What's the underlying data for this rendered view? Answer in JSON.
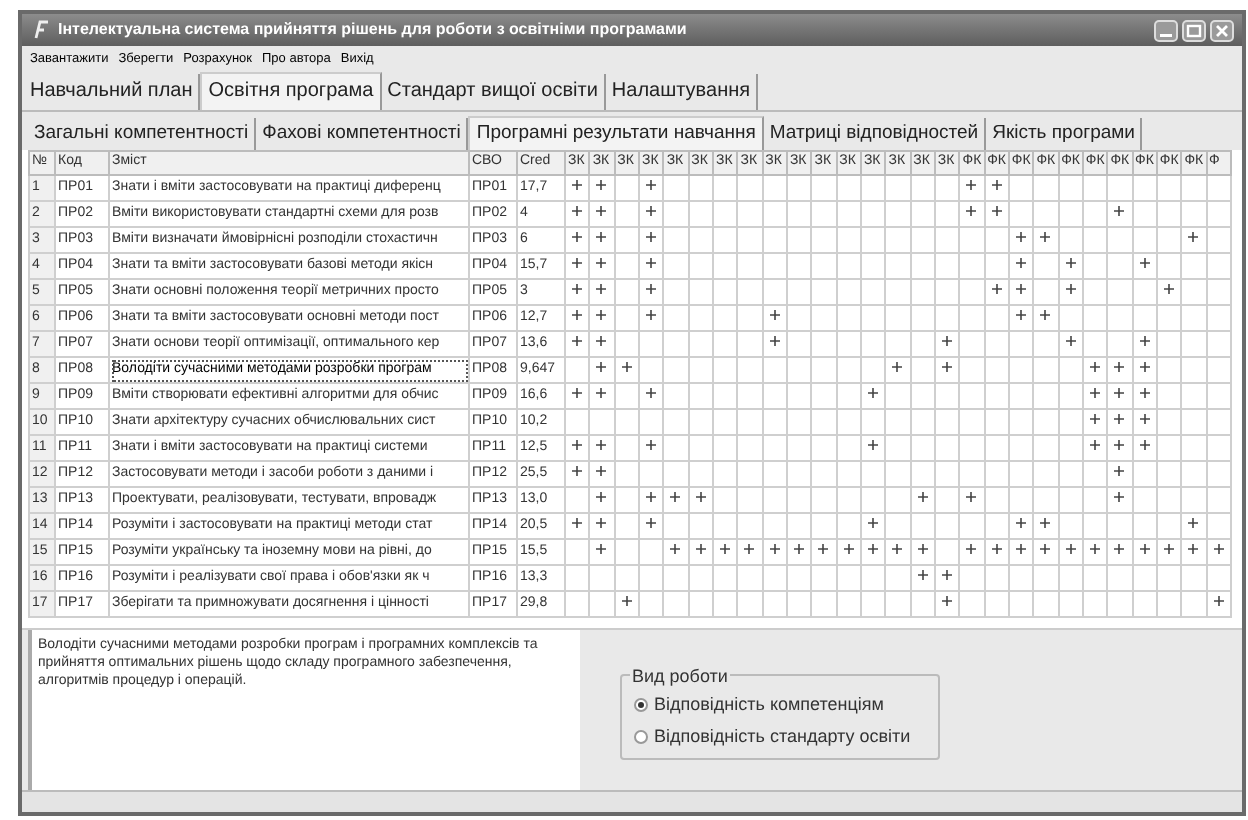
{
  "window": {
    "title": "Інтелектуальна система прийняття рішень для роботи з освітніми програмами"
  },
  "menu": [
    "Завантажити",
    "Зберегти",
    "Розрахунок",
    "Про автора",
    "Вихід"
  ],
  "tabs": [
    {
      "label": "Навчальний план",
      "selected": false
    },
    {
      "label": "Освітня програма",
      "selected": true
    },
    {
      "label": "Стандарт вищої освіти",
      "selected": false
    },
    {
      "label": "Налаштування",
      "selected": false
    }
  ],
  "subtabs": [
    {
      "label": "Загальні компетентності",
      "selected": false
    },
    {
      "label": "Фахові компетентності",
      "selected": false
    },
    {
      "label": "Програмні результати навчання",
      "selected": true
    },
    {
      "label": "Матриці відповідностей",
      "selected": false
    },
    {
      "label": "Якість програми",
      "selected": false
    }
  ],
  "table": {
    "columns": [
      "№",
      "Код",
      "Зміст",
      "СВО",
      "Cred",
      "ЗК",
      "ЗК",
      "ЗК",
      "ЗК",
      "ЗК",
      "ЗК",
      "ЗК",
      "ЗК",
      "ЗК",
      "ЗК",
      "ЗК",
      "ЗК",
      "ЗК",
      "ЗК",
      "ЗК",
      "ЗК",
      "ФК",
      "ФК",
      "ФК",
      "ФК",
      "ФК",
      "ФК",
      "ФК",
      "ФК",
      "ФК",
      "ФК",
      "Ф"
    ],
    "rows": [
      {
        "n": "1",
        "code": "ПР01",
        "text": "Знати і вміти застосовувати на практиці диференц",
        "svo": "ПР01",
        "cred": "17,7",
        "selected": false,
        "marks": [
          true,
          true,
          false,
          true,
          false,
          false,
          false,
          false,
          false,
          false,
          false,
          false,
          false,
          false,
          false,
          false,
          true,
          true,
          false,
          false,
          false,
          false,
          false,
          false,
          false,
          false,
          false
        ]
      },
      {
        "n": "2",
        "code": "ПР02",
        "text": "Вміти використовувати стандартні схеми для розв",
        "svo": "ПР02",
        "cred": "4",
        "selected": false,
        "marks": [
          true,
          true,
          false,
          true,
          false,
          false,
          false,
          false,
          false,
          false,
          false,
          false,
          false,
          false,
          false,
          false,
          true,
          true,
          false,
          false,
          false,
          false,
          true,
          false,
          false,
          false,
          false
        ]
      },
      {
        "n": "3",
        "code": "ПР03",
        "text": "Вміти визначати ймовірнісні розподіли стохастичн",
        "svo": "ПР03",
        "cred": "6",
        "selected": false,
        "marks": [
          true,
          true,
          false,
          true,
          false,
          false,
          false,
          false,
          false,
          false,
          false,
          false,
          false,
          false,
          false,
          false,
          false,
          false,
          true,
          true,
          false,
          false,
          false,
          false,
          false,
          true,
          false
        ]
      },
      {
        "n": "4",
        "code": "ПР04",
        "text": "Знати та вміти застосовувати базові методи якісн",
        "svo": "ПР04",
        "cred": "15,7",
        "selected": false,
        "marks": [
          true,
          true,
          false,
          true,
          false,
          false,
          false,
          false,
          false,
          false,
          false,
          false,
          false,
          false,
          false,
          false,
          false,
          false,
          true,
          false,
          true,
          false,
          false,
          true,
          false,
          false,
          false
        ]
      },
      {
        "n": "5",
        "code": "ПР05",
        "text": "Знати основні положення теорії метричних просто",
        "svo": "ПР05",
        "cred": "3",
        "selected": false,
        "marks": [
          true,
          true,
          false,
          true,
          false,
          false,
          false,
          false,
          false,
          false,
          false,
          false,
          false,
          false,
          false,
          false,
          false,
          true,
          true,
          false,
          true,
          false,
          false,
          false,
          true,
          false,
          false
        ]
      },
      {
        "n": "6",
        "code": "ПР06",
        "text": "Знати та вміти застосовувати основні методи пост",
        "svo": "ПР06",
        "cred": "12,7",
        "selected": false,
        "marks": [
          true,
          true,
          false,
          true,
          false,
          false,
          false,
          false,
          true,
          false,
          false,
          false,
          false,
          false,
          false,
          false,
          false,
          false,
          true,
          true,
          false,
          false,
          false,
          false,
          false,
          false,
          false
        ]
      },
      {
        "n": "7",
        "code": "ПР07",
        "text": "Знати основи теорії оптимізації, оптимального кер",
        "svo": "ПР07",
        "cred": "13,6",
        "selected": false,
        "marks": [
          true,
          true,
          false,
          false,
          false,
          false,
          false,
          false,
          true,
          false,
          false,
          false,
          false,
          false,
          false,
          true,
          false,
          false,
          false,
          false,
          true,
          false,
          false,
          true,
          false,
          false,
          false
        ]
      },
      {
        "n": "8",
        "code": "ПР08",
        "text": "Володіти сучасними методами розробки програм",
        "svo": "ПР08",
        "cred": "9,647",
        "selected": true,
        "marks": [
          false,
          true,
          true,
          false,
          false,
          false,
          false,
          false,
          false,
          false,
          false,
          false,
          false,
          true,
          false,
          true,
          false,
          false,
          false,
          false,
          false,
          true,
          true,
          true,
          false,
          false,
          false
        ]
      },
      {
        "n": "9",
        "code": "ПР09",
        "text": "Вміти створювати ефективні алгоритми для обчис",
        "svo": "ПР09",
        "cred": "16,6",
        "selected": false,
        "marks": [
          true,
          true,
          false,
          true,
          false,
          false,
          false,
          false,
          false,
          false,
          false,
          false,
          true,
          false,
          false,
          false,
          false,
          false,
          false,
          false,
          false,
          true,
          true,
          true,
          false,
          false,
          false
        ]
      },
      {
        "n": "10",
        "code": "ПР10",
        "text": "Знати архітектуру сучасних обчислювальних сист",
        "svo": "ПР10",
        "cred": "10,2",
        "selected": false,
        "marks": [
          false,
          false,
          false,
          false,
          false,
          false,
          false,
          false,
          false,
          false,
          false,
          false,
          false,
          false,
          false,
          false,
          false,
          false,
          false,
          false,
          false,
          true,
          true,
          true,
          false,
          false,
          false
        ]
      },
      {
        "n": "11",
        "code": "ПР11",
        "text": "Знати і вміти застосовувати на практиці системи",
        "svo": "ПР11",
        "cred": "12,5",
        "selected": false,
        "marks": [
          true,
          true,
          false,
          true,
          false,
          false,
          false,
          false,
          false,
          false,
          false,
          false,
          true,
          false,
          false,
          false,
          false,
          false,
          false,
          false,
          false,
          true,
          true,
          true,
          false,
          false,
          false
        ]
      },
      {
        "n": "12",
        "code": "ПР12",
        "text": "Застосовувати методи і засоби роботи з даними і",
        "svo": "ПР12",
        "cred": "25,5",
        "selected": false,
        "marks": [
          true,
          true,
          false,
          false,
          false,
          false,
          false,
          false,
          false,
          false,
          false,
          false,
          false,
          false,
          false,
          false,
          false,
          false,
          false,
          false,
          false,
          false,
          true,
          false,
          false,
          false,
          false
        ]
      },
      {
        "n": "13",
        "code": "ПР13",
        "text": "Проектувати, реалізовувати, тестувати, впровадж",
        "svo": "ПР13",
        "cred": "13,0",
        "selected": false,
        "marks": [
          false,
          true,
          false,
          true,
          true,
          true,
          false,
          false,
          false,
          false,
          false,
          false,
          false,
          false,
          true,
          false,
          true,
          false,
          false,
          false,
          false,
          false,
          true,
          false,
          false,
          false,
          false
        ]
      },
      {
        "n": "14",
        "code": "ПР14",
        "text": "Розуміти і застосовувати на практиці методи стат",
        "svo": "ПР14",
        "cred": "20,5",
        "selected": false,
        "marks": [
          true,
          true,
          false,
          true,
          false,
          false,
          false,
          false,
          false,
          false,
          false,
          false,
          true,
          false,
          false,
          false,
          false,
          false,
          true,
          true,
          false,
          false,
          false,
          false,
          false,
          true,
          false
        ]
      },
      {
        "n": "15",
        "code": "ПР15",
        "text": "Розуміти українську та іноземну мови на рівні, до",
        "svo": "ПР15",
        "cred": "15,5",
        "selected": false,
        "marks": [
          false,
          true,
          false,
          false,
          true,
          true,
          true,
          true,
          true,
          true,
          true,
          true,
          true,
          true,
          true,
          false,
          true,
          true,
          true,
          true,
          true,
          true,
          true,
          true,
          true,
          true,
          true
        ]
      },
      {
        "n": "16",
        "code": "ПР16",
        "text": "Розуміти і реалізувати свої права і обов'язки як ч",
        "svo": "ПР16",
        "cred": "13,3",
        "selected": false,
        "marks": [
          false,
          false,
          false,
          false,
          false,
          false,
          false,
          false,
          false,
          false,
          false,
          false,
          false,
          false,
          true,
          true,
          false,
          false,
          false,
          false,
          false,
          false,
          false,
          false,
          false,
          false,
          false
        ]
      },
      {
        "n": "17",
        "code": "ПР17",
        "text": "Зберігати та примножувати досягнення і цінності",
        "svo": "ПР17",
        "cred": "29,8",
        "selected": false,
        "marks": [
          false,
          false,
          true,
          false,
          false,
          false,
          false,
          false,
          false,
          false,
          false,
          false,
          false,
          false,
          false,
          true,
          false,
          false,
          false,
          false,
          false,
          false,
          false,
          false,
          false,
          false,
          true
        ]
      }
    ]
  },
  "description": "Володіти сучасними методами розробки програм і програмних комплексів та прийняття оптимальних рішень щодо складу програмного забезпечення, алгоритмів процедур і операцій.",
  "work_mode": {
    "title": "Вид роботи",
    "options": [
      {
        "label": "Відповідність компетенціям",
        "selected": true
      },
      {
        "label": "Відповідність стандарту освіти",
        "selected": false
      }
    ]
  }
}
